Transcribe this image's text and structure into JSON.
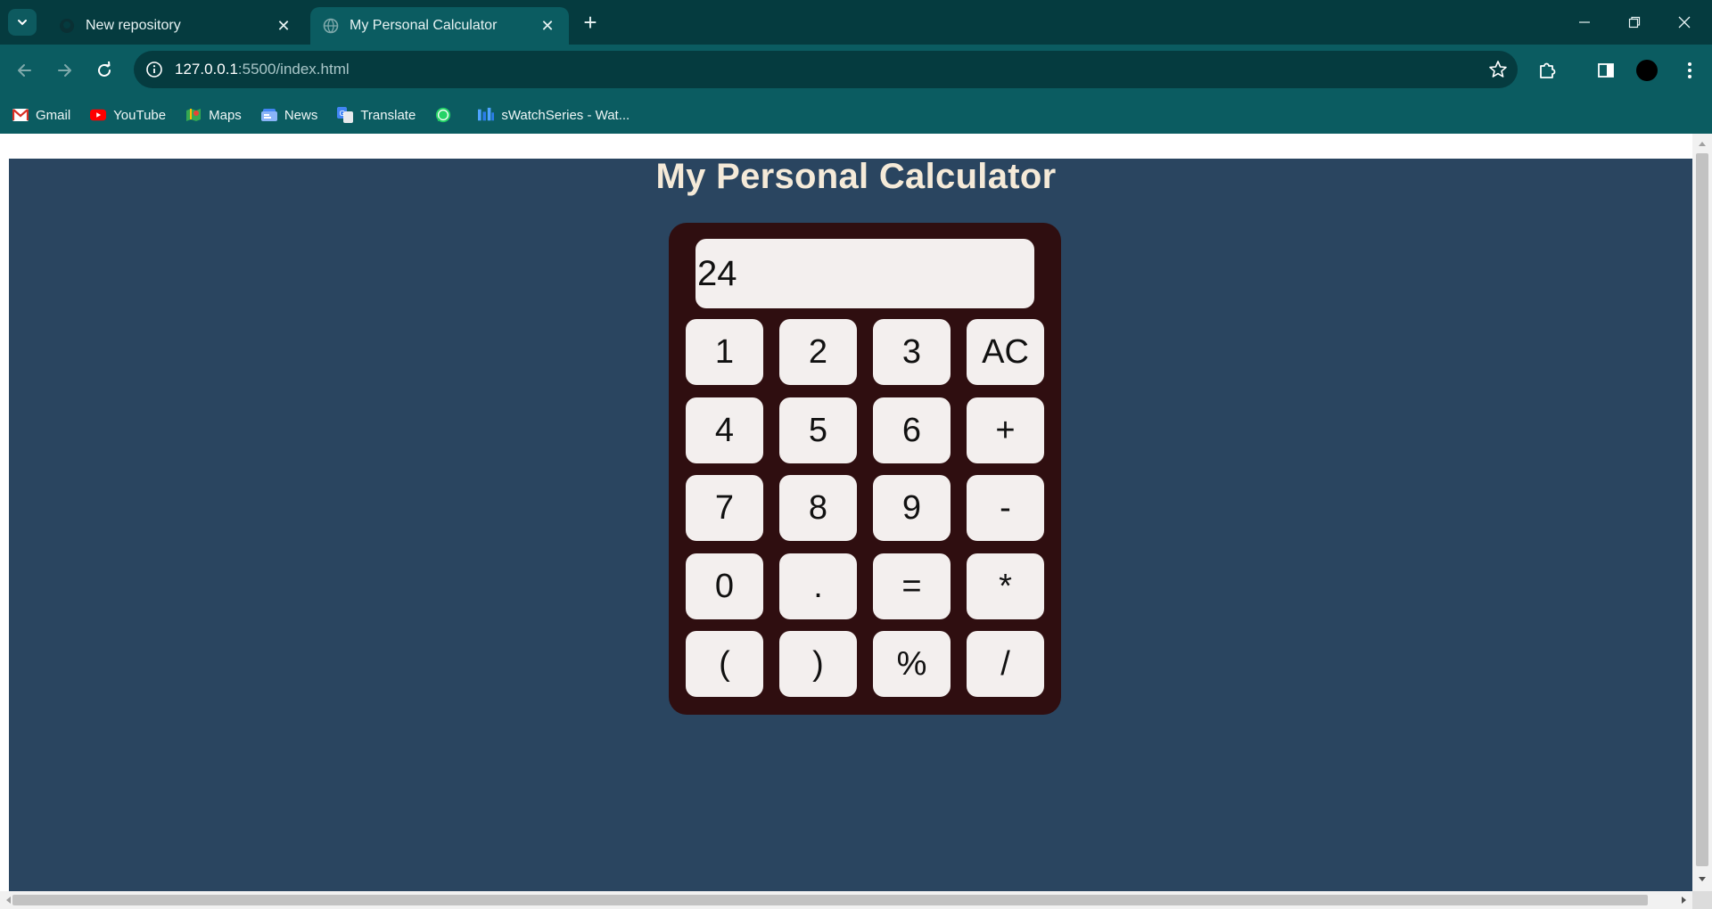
{
  "browser": {
    "tabs": [
      {
        "title": "New repository",
        "active": false
      },
      {
        "title": "My Personal Calculator",
        "active": true
      }
    ],
    "url_host": "127.0.0.1",
    "url_path": ":5500/index.html",
    "bookmarks": [
      {
        "label": "Gmail",
        "icon": "gmail-icon"
      },
      {
        "label": "YouTube",
        "icon": "youtube-icon"
      },
      {
        "label": "Maps",
        "icon": "maps-icon"
      },
      {
        "label": "News",
        "icon": "news-icon"
      },
      {
        "label": "Translate",
        "icon": "translate-icon"
      },
      {
        "label": "",
        "icon": "whatsapp-icon"
      },
      {
        "label": "sWatchSeries - Wat...",
        "icon": "swatchseries-icon"
      }
    ],
    "colors": {
      "titlebar": "#053b3f",
      "toolbar": "#0b5c61"
    }
  },
  "page": {
    "title": "My Personal Calculator",
    "background": "#2a4560",
    "calculator": {
      "display_value": "24",
      "body_color": "#2f0e10",
      "keys": [
        [
          "1",
          "2",
          "3",
          "AC"
        ],
        [
          "4",
          "5",
          "6",
          "+"
        ],
        [
          "7",
          "8",
          "9",
          "-"
        ],
        [
          "0",
          ".",
          "=",
          "*"
        ],
        [
          "(",
          ")",
          "%",
          "/"
        ]
      ]
    }
  }
}
